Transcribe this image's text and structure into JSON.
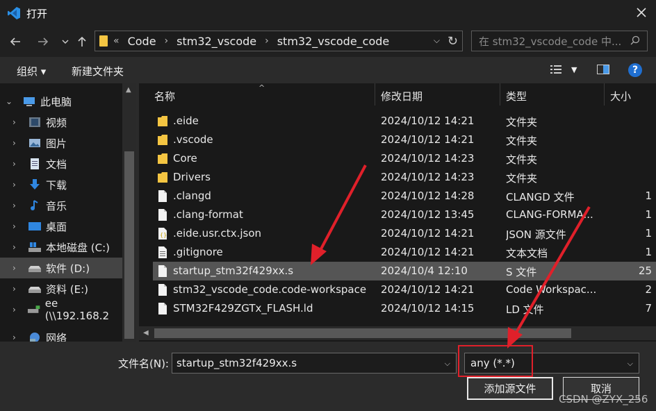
{
  "window": {
    "title": "打开"
  },
  "address": {
    "crumbs": [
      "Code",
      "stm32_vscode",
      "stm32_vscode_code"
    ],
    "overflow": "«"
  },
  "search": {
    "placeholder": "在 stm32_vscode_code 中..."
  },
  "toolbar": {
    "organize": "组织",
    "new_folder": "新建文件夹",
    "help": "?"
  },
  "sidebar": {
    "items": [
      {
        "label": "此电脑",
        "icon": "computer-icon"
      },
      {
        "label": "视频",
        "icon": "video-icon"
      },
      {
        "label": "图片",
        "icon": "picture-icon"
      },
      {
        "label": "文档",
        "icon": "document-icon"
      },
      {
        "label": "下载",
        "icon": "download-icon"
      },
      {
        "label": "音乐",
        "icon": "music-icon"
      },
      {
        "label": "桌面",
        "icon": "desktop-icon"
      },
      {
        "label": "本地磁盘 (C:)",
        "icon": "windows-drive-icon"
      },
      {
        "label": "软件 (D:)",
        "icon": "drive-icon"
      },
      {
        "label": "资料 (E:)",
        "icon": "drive-icon"
      },
      {
        "label": "ee (\\\\192.168.2",
        "icon": "network-drive-icon"
      },
      {
        "label": "网络",
        "icon": "network-icon"
      }
    ]
  },
  "columns": {
    "name": "名称",
    "modified": "修改日期",
    "type": "类型",
    "size": "大小"
  },
  "files": [
    {
      "name": ".eide",
      "modified": "2024/10/12 14:21",
      "type": "文件夹",
      "size": "",
      "kind": "folder"
    },
    {
      "name": ".vscode",
      "modified": "2024/10/12 14:21",
      "type": "文件夹",
      "size": "",
      "kind": "folder"
    },
    {
      "name": "Core",
      "modified": "2024/10/12 14:23",
      "type": "文件夹",
      "size": "",
      "kind": "folder"
    },
    {
      "name": "Drivers",
      "modified": "2024/10/12 14:23",
      "type": "文件夹",
      "size": "",
      "kind": "folder"
    },
    {
      "name": ".clangd",
      "modified": "2024/10/12 14:28",
      "type": "CLANGD 文件",
      "size": "1",
      "kind": "file"
    },
    {
      "name": ".clang-format",
      "modified": "2024/10/12 13:45",
      "type": "CLANG-FORMA...",
      "size": "1",
      "kind": "file"
    },
    {
      "name": ".eide.usr.ctx.json",
      "modified": "2024/10/12 14:21",
      "type": "JSON 源文件",
      "size": "1",
      "kind": "json"
    },
    {
      "name": ".gitignore",
      "modified": "2024/10/12 14:21",
      "type": "文本文档",
      "size": "1",
      "kind": "text"
    },
    {
      "name": "startup_stm32f429xx.s",
      "modified": "2024/10/4 12:10",
      "type": "S 文件",
      "size": "25",
      "kind": "file"
    },
    {
      "name": "stm32_vscode_code.code-workspace",
      "modified": "2024/10/12 14:21",
      "type": "Code Workspac...",
      "size": "2",
      "kind": "file"
    },
    {
      "name": "STM32F429ZGTx_FLASH.ld",
      "modified": "2024/10/12 14:15",
      "type": "LD 文件",
      "size": "7",
      "kind": "file"
    }
  ],
  "bottom": {
    "filename_label": "文件名(N):",
    "filename_value": "startup_stm32f429xx.s",
    "filter_value": "any (*.*)",
    "add_button": "添加源文件",
    "cancel_button": "取消"
  },
  "watermark": "CSDN @ZYX_256",
  "colors": {
    "folder": "#f4c542",
    "accent": "#1f6fd1",
    "annotation": "#e0202a"
  }
}
